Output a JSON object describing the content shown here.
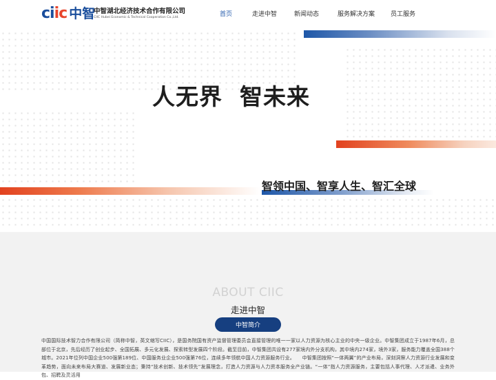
{
  "header": {
    "logo_mark_ciic_1": "ci",
    "logo_mark_ciic_2": "ic",
    "logo_mark_cn": "中智",
    "logo_cn": "中智湖北经济技术合作有限公司",
    "logo_en": "CIIC Hubei Economic & Technical Cooperation Co.,Ltd.",
    "nav": [
      {
        "label": "首页",
        "active": true
      },
      {
        "label": "走进中智",
        "active": false
      },
      {
        "label": "新闻动态",
        "active": false
      },
      {
        "label": "服务解决方案",
        "active": false
      },
      {
        "label": "员工服务",
        "active": false
      }
    ]
  },
  "hero": {
    "title": "人无界  智未来",
    "subtitle": "智领中国、智享人生、智汇全球"
  },
  "about": {
    "heading_en": "ABOUT CIIC",
    "heading_cn": "走进中智",
    "button_label": "中智简介",
    "body": "中国国际技术智力合作有限公司（简称中智，英文缩写CIIC），是国务院国有资产监督管理委员会直接管理的唯一一家以人力资源为核心主业的中央一级企业。中智集团成立于1987年6月，总部位于北京，先后经历了创业起步、全国拓展、多元化发展、探索转型发展四个阶段。截至目前，中智集团共设有277家境内外分支机构，其中境内274家，境外3家，服务能力覆盖全国388个城市。2021年位列中国企业500强第189位、中国服务业企业500强第76位，连续多年领航中国人力资源服务行业。　　中智集团按照“一体两翼”的产业布局，深刻洞察人力资源行业发展和变革趋势，面向未来布局大赛道、发展新业态；秉持“技术创新、技术领先”发展理念，打造人力资源与人力资本服务全产业链。“一体”指人力资源服务，主要包括人事代理、人才派遣、业务外包、招聘及灵活用"
  }
}
